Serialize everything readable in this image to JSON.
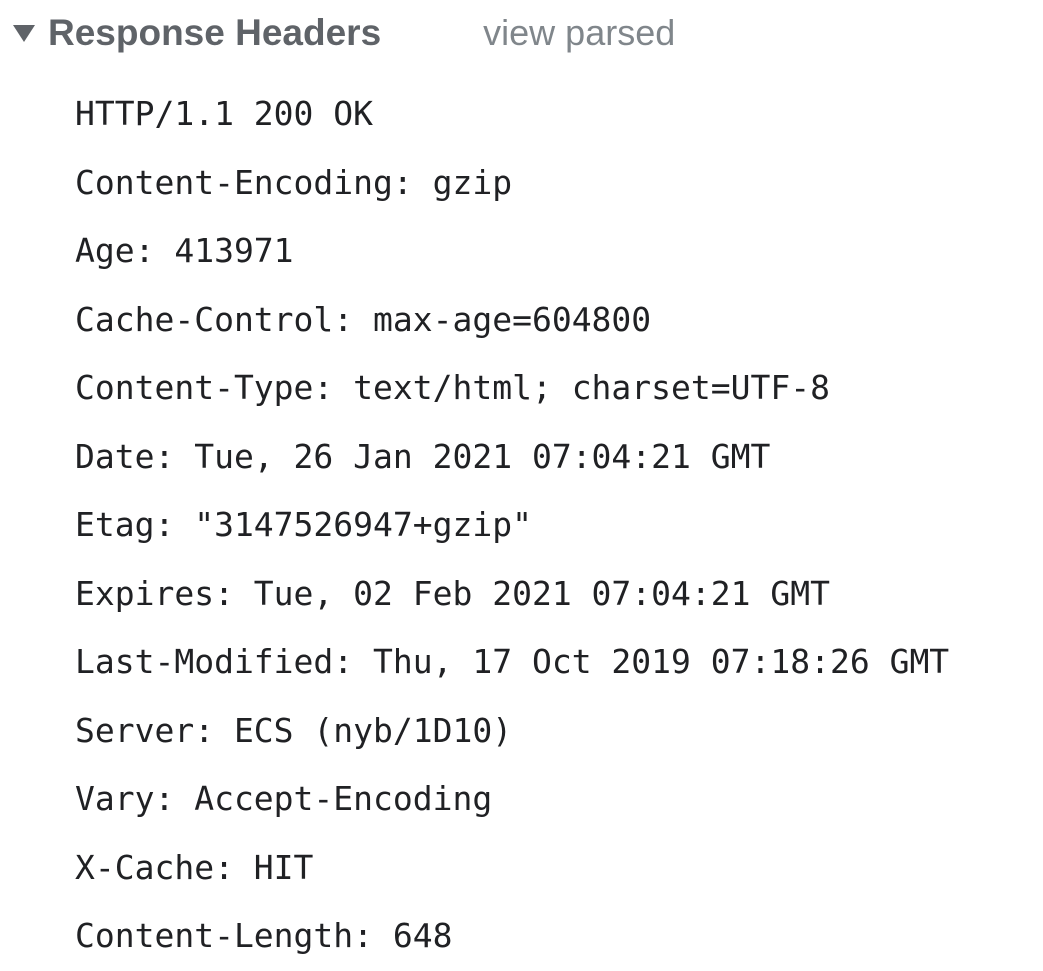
{
  "response_headers": {
    "title": "Response Headers",
    "view_toggle_label": "view parsed",
    "lines": [
      "HTTP/1.1 200 OK",
      "Content-Encoding: gzip",
      "Age: 413971",
      "Cache-Control: max-age=604800",
      "Content-Type: text/html; charset=UTF-8",
      "Date: Tue, 26 Jan 2021 07:04:21 GMT",
      "Etag: \"3147526947+gzip\"",
      "Expires: Tue, 02 Feb 2021 07:04:21 GMT",
      "Last-Modified: Thu, 17 Oct 2019 07:18:26 GMT",
      "Server: ECS (nyb/1D10)",
      "Vary: Accept-Encoding",
      "X-Cache: HIT",
      "Content-Length: 648"
    ]
  },
  "icons": {
    "expand_toggle": "triangle-down-icon"
  },
  "colors": {
    "title": "#5f6368",
    "toggle_link": "#80868b",
    "header_text": "#202124"
  }
}
